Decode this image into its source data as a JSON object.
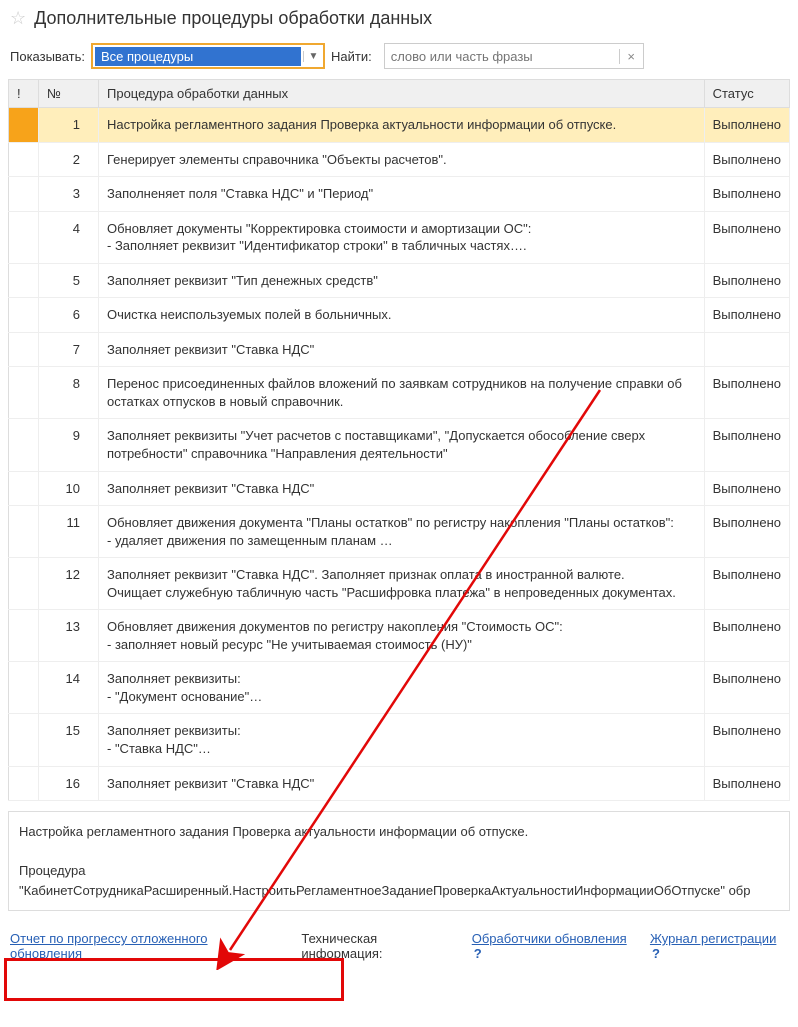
{
  "header": {
    "title": "Дополнительные процедуры обработки данных"
  },
  "toolbar": {
    "show_label": "Показывать:",
    "dropdown_value": "Все процедуры",
    "find_label": "Найти:",
    "search_placeholder": "слово или часть фразы"
  },
  "table": {
    "headers": {
      "priority": "!",
      "num": "№",
      "procedure": "Процедура обработки данных",
      "status": "Статус"
    },
    "rows": [
      {
        "num": "1",
        "procedure": "Настройка регламентного задания Проверка актуальности информации об отпуске.",
        "status": "Выполнено",
        "selected": true
      },
      {
        "num": "2",
        "procedure": "Генерирует элементы справочника \"Объекты расчетов\".",
        "status": "Выполнено"
      },
      {
        "num": "3",
        "procedure": "Заполненяет поля \"Ставка НДС\" и \"Период\"",
        "status": "Выполнено"
      },
      {
        "num": "4",
        "procedure": "Обновляет документы \"Корректировка стоимости и амортизации ОС\":\n- Заполняет реквизит \"Идентификатор строки\" в табличных частях….",
        "status": "Выполнено"
      },
      {
        "num": "5",
        "procedure": "Заполняет реквизит \"Тип денежных средств\"",
        "status": "Выполнено"
      },
      {
        "num": "6",
        "procedure": "Очистка неиспользуемых полей в больничных.",
        "status": "Выполнено"
      },
      {
        "num": "7",
        "procedure": "Заполняет реквизит \"Ставка НДС\"",
        "status": ""
      },
      {
        "num": "8",
        "procedure": "Перенос присоединенных файлов вложений по заявкам сотрудников на получение справки об остатках отпусков в новый справочник.",
        "status": "Выполнено"
      },
      {
        "num": "9",
        "procedure": "Заполняет реквизиты \"Учет расчетов с поставщиками\", \"Допускается обособление сверх потребности\" справочника \"Направления деятельности\"",
        "status": "Выполнено"
      },
      {
        "num": "10",
        "procedure": "Заполняет реквизит \"Ставка НДС\"",
        "status": "Выполнено"
      },
      {
        "num": "11",
        "procedure": "Обновляет движения документа \"Планы остатков\" по регистру накопления \"Планы остатков\":\n - удаляет движения по замещенным планам …",
        "status": "Выполнено"
      },
      {
        "num": "12",
        "procedure": "Заполняет реквизит \"Ставка НДС\". Заполняет признак оплата в иностранной валюте.\nОчищает служебную табличную часть \"Расшифровка платежа\" в непроведенных документах.",
        "status": "Выполнено"
      },
      {
        "num": "13",
        "procedure": "Обновляет движения документов по регистру накопления \"Стоимость ОС\":\n- заполняет новый ресурс \"Не учитываемая стоимость (НУ)\"",
        "status": "Выполнено"
      },
      {
        "num": "14",
        "procedure": "Заполняет реквизиты:\n- \"Документ основание\"…",
        "status": "Выполнено"
      },
      {
        "num": "15",
        "procedure": "Заполняет реквизиты:\n- \"Ставка НДС\"…",
        "status": "Выполнено"
      },
      {
        "num": "16",
        "procedure": "Заполняет реквизит \"Ставка НДС\"",
        "status": "Выполнено"
      }
    ]
  },
  "details": {
    "line1": "Настройка регламентного задания Проверка актуальности информации об отпуске.",
    "line2": "Процедура \"КабинетСотрудникаРасширенный.НастроитьРегламентноеЗаданиеПроверкаАктуальностиИнформацииОбОтпуске\" обр"
  },
  "footer": {
    "report_link": "Отчет по прогрессу отложенного обновления",
    "tech_info_label": "Техническая информация:",
    "handlers_link": "Обработчики обновления",
    "journal_link": "Журнал регистрации"
  }
}
